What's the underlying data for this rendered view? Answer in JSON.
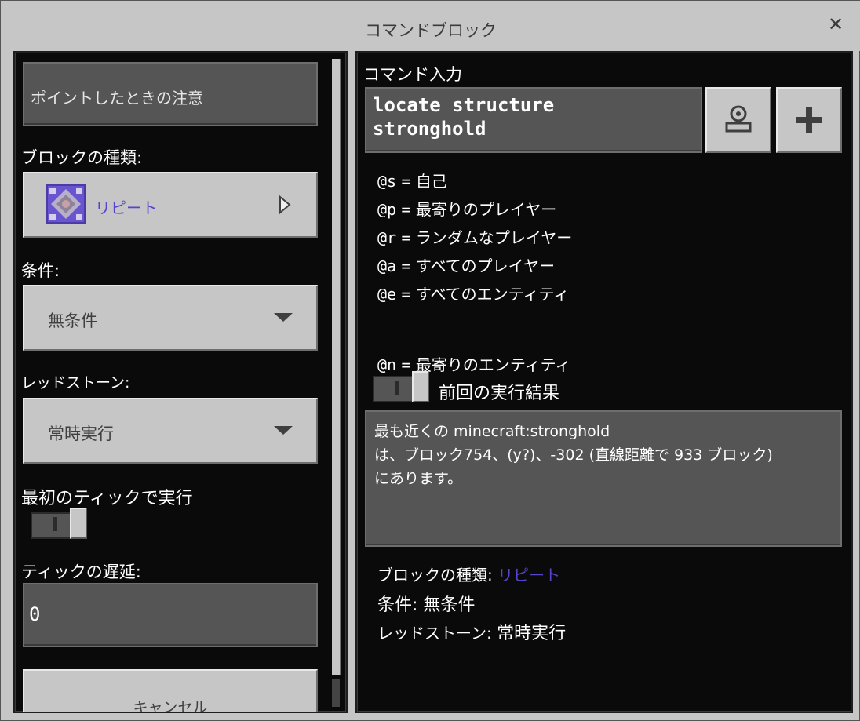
{
  "window": {
    "title": "コマンドブロック",
    "close_glyph": "✕"
  },
  "left": {
    "hover_note_label": "ポイントしたときの注意",
    "block_type_label": "ブロックの種類:",
    "block_type_value": "リピート",
    "condition_label": "条件:",
    "condition_value": "無条件",
    "redstone_label": "レッドストーン:",
    "redstone_value": "常時実行",
    "first_tick_label": "最初のティックで実行",
    "tick_delay_label": "ティックの遅延:",
    "tick_delay_value": "0",
    "cancel_label": "キャンセル"
  },
  "right": {
    "command_input_label": "コマンド入力",
    "command_value": "locate structure\nstronghold",
    "selectors": [
      {
        "code": "@s",
        "eq": "=",
        "desc": "自己"
      },
      {
        "code": "@p",
        "eq": "=",
        "desc": "最寄りのプレイヤー"
      },
      {
        "code": "@r",
        "eq": "=",
        "desc": "ランダムなプレイヤー"
      },
      {
        "code": "@a",
        "eq": "=",
        "desc": "すべてのプレイヤー"
      },
      {
        "code": "@e",
        "eq": "=",
        "desc": "すべてのエンティティ"
      },
      {
        "code": "@n",
        "eq": "=",
        "desc": "最寄りのエンティティ"
      }
    ],
    "previous_output_label": "前回の実行結果",
    "output_text": "最も近くの minecraft:stronghold\nは、ブロック754、(y?)、-302 (直線距離で 933 ブロック)\nにあります。",
    "summary": {
      "block_type_label": "ブロックの種類:",
      "block_type_value": "リピート",
      "condition_label": "条件:",
      "condition_value": "無条件",
      "redstone_label": "レッドストーン:",
      "redstone_value": "常時実行"
    }
  },
  "colors": {
    "panel_bg": "#0a0a0a",
    "window_bg": "#c6c6c6",
    "field_bg": "#555555",
    "accent_purple": "#5544cc"
  },
  "icons": [
    "close-icon",
    "command-block-icon",
    "play-arrow-icon",
    "chevron-down-icon",
    "import-icon",
    "plus-icon"
  ]
}
